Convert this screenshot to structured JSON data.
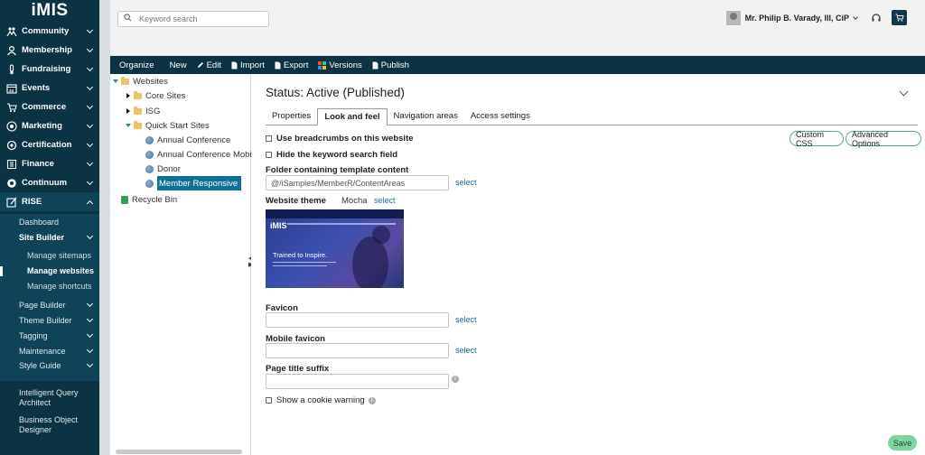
{
  "sidebar": {
    "logo": "iMIS",
    "items": [
      {
        "label": "Community",
        "icon": "community-icon"
      },
      {
        "label": "Membership",
        "icon": "membership-icon"
      },
      {
        "label": "Fundraising",
        "icon": "fundraising-icon"
      },
      {
        "label": "Events",
        "icon": "events-icon"
      },
      {
        "label": "Commerce",
        "icon": "commerce-icon"
      },
      {
        "label": "Marketing",
        "icon": "marketing-icon"
      },
      {
        "label": "Certification",
        "icon": "certification-icon"
      },
      {
        "label": "Finance",
        "icon": "finance-icon"
      },
      {
        "label": "Continuum",
        "icon": "continuum-icon"
      },
      {
        "label": "RISE",
        "icon": "rise-icon"
      }
    ],
    "rise_sub": {
      "dashboard": "Dashboard",
      "site_builder": "Site Builder",
      "manage_sitemaps": "Manage sitemaps",
      "manage_websites": "Manage websites",
      "manage_shortcuts": "Manage shortcuts",
      "page_builder": "Page Builder",
      "theme_builder": "Theme Builder",
      "tagging": "Tagging",
      "maintenance": "Maintenance",
      "style_guide": "Style Guide"
    },
    "extra": [
      "Intelligent Query Architect",
      "Business Object Designer"
    ]
  },
  "header": {
    "search_placeholder": "Keyword search",
    "user_name": "Mr. Philip B. Varady, III, CiP"
  },
  "toolbar": {
    "organize": "Organize",
    "new": "New",
    "edit": "Edit",
    "import": "Import",
    "export": "Export",
    "versions": "Versions",
    "publish": "Publish"
  },
  "tree": {
    "websites": "Websites",
    "core_sites": "Core Sites",
    "isg": "ISG",
    "quick_start_sites": "Quick Start Sites",
    "annual_conference": "Annual Conference",
    "annual_conference_mobile": "Annual Conference Mobile",
    "donor": "Donor",
    "member_responsive": "Member Responsive",
    "recycle_bin": "Recycle Bin"
  },
  "main": {
    "status": "Status: Active (Published)",
    "tabs": [
      "Properties",
      "Look and feel",
      "Navigation areas",
      "Access settings"
    ],
    "active_tab": "Look and feel",
    "use_breadcrumbs": "Use breadcrumbs on this website",
    "hide_search": "Hide the keyword search field",
    "custom_css": "Custom CSS",
    "advanced_options": "Advanced Options",
    "folder_label": "Folder containing template content",
    "folder_value": "@/iSamples/MemberR/ContentAreas",
    "select": "select",
    "theme_label": "Website theme",
    "theme_value": "Mocha",
    "preview_logo": "iMIS",
    "preview_tagline": "Trained to Inspire.",
    "favicon_label": "Favicon",
    "mobile_favicon_label": "Mobile favicon",
    "page_title_suffix_label": "Page title suffix",
    "cookie_warning": "Show a cookie warning",
    "save": "Save"
  },
  "colors": {
    "sidebar_bg": "#0b3344",
    "toolbar_bg": "#0b3344",
    "selected_bg": "#0e6f99",
    "link": "#1b6b9a",
    "save_bg": "#7fd4a0"
  }
}
